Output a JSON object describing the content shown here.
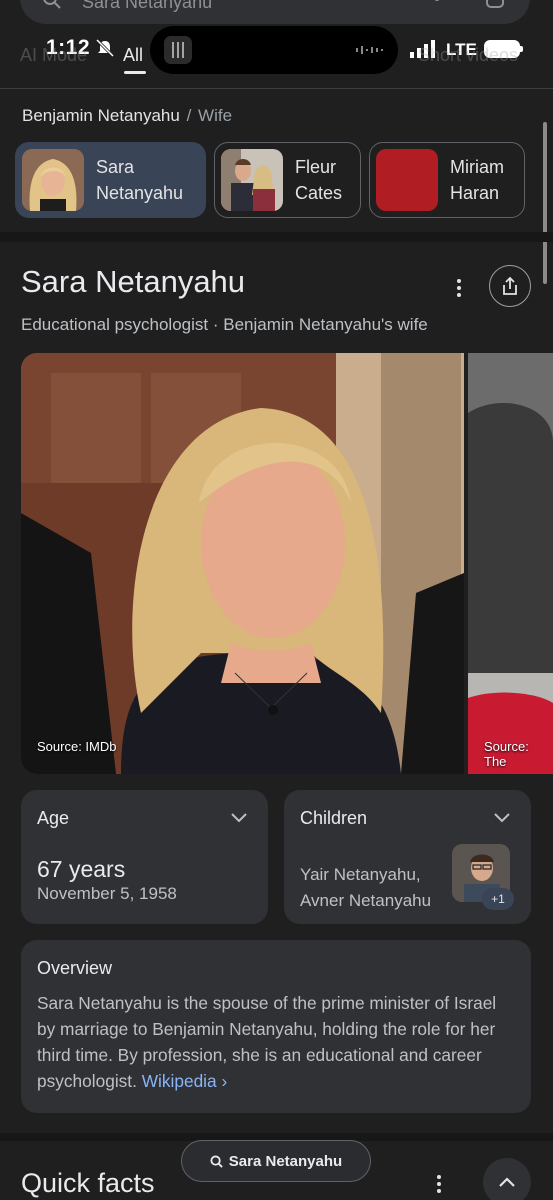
{
  "search": {
    "query": "Sara Netanyahu"
  },
  "status": {
    "time": "1:12",
    "network": "LTE"
  },
  "tabs": [
    {
      "label": "AI Mode"
    },
    {
      "label": "All"
    },
    {
      "label": "Short videos"
    }
  ],
  "breadcrumb": {
    "parent": "Benjamin Netanyahu",
    "separator": "/",
    "current": "Wife"
  },
  "chips": [
    {
      "line1": "Sara",
      "line2": "Netanyahu"
    },
    {
      "line1": "Fleur",
      "line2": "Cates"
    },
    {
      "line1": "Miriam",
      "line2": "Haran"
    }
  ],
  "entity": {
    "name": "Sara Netanyahu",
    "subtitle": "Educational psychologist · Benjamin Netanyahu's wife"
  },
  "images": [
    {
      "source": "Source: IMDb"
    },
    {
      "source": "Source: The"
    }
  ],
  "age_card": {
    "title": "Age",
    "value": "67 years",
    "date": "November 5, 1958"
  },
  "children_card": {
    "title": "Children",
    "line1": "Yair Netanyahu,",
    "line2": "Avner Netanyahu",
    "more": "+1"
  },
  "overview": {
    "title": "Overview",
    "text": "Sara Netanyahu is the spouse of the prime minister of Israel by marriage to Benjamin Netanyahu, holding the role for her third time. By profession, she is an educational and career psychologist.",
    "link": "Wikipedia"
  },
  "quick_facts": {
    "title": "Quick facts"
  },
  "floating_search": {
    "label": "Sara Netanyahu"
  },
  "colors": {
    "background": "#1f1f1f",
    "card": "#303134",
    "active_chip": "#394457",
    "link": "#8ab4f8",
    "chip3_thumb": "#b01e23"
  }
}
